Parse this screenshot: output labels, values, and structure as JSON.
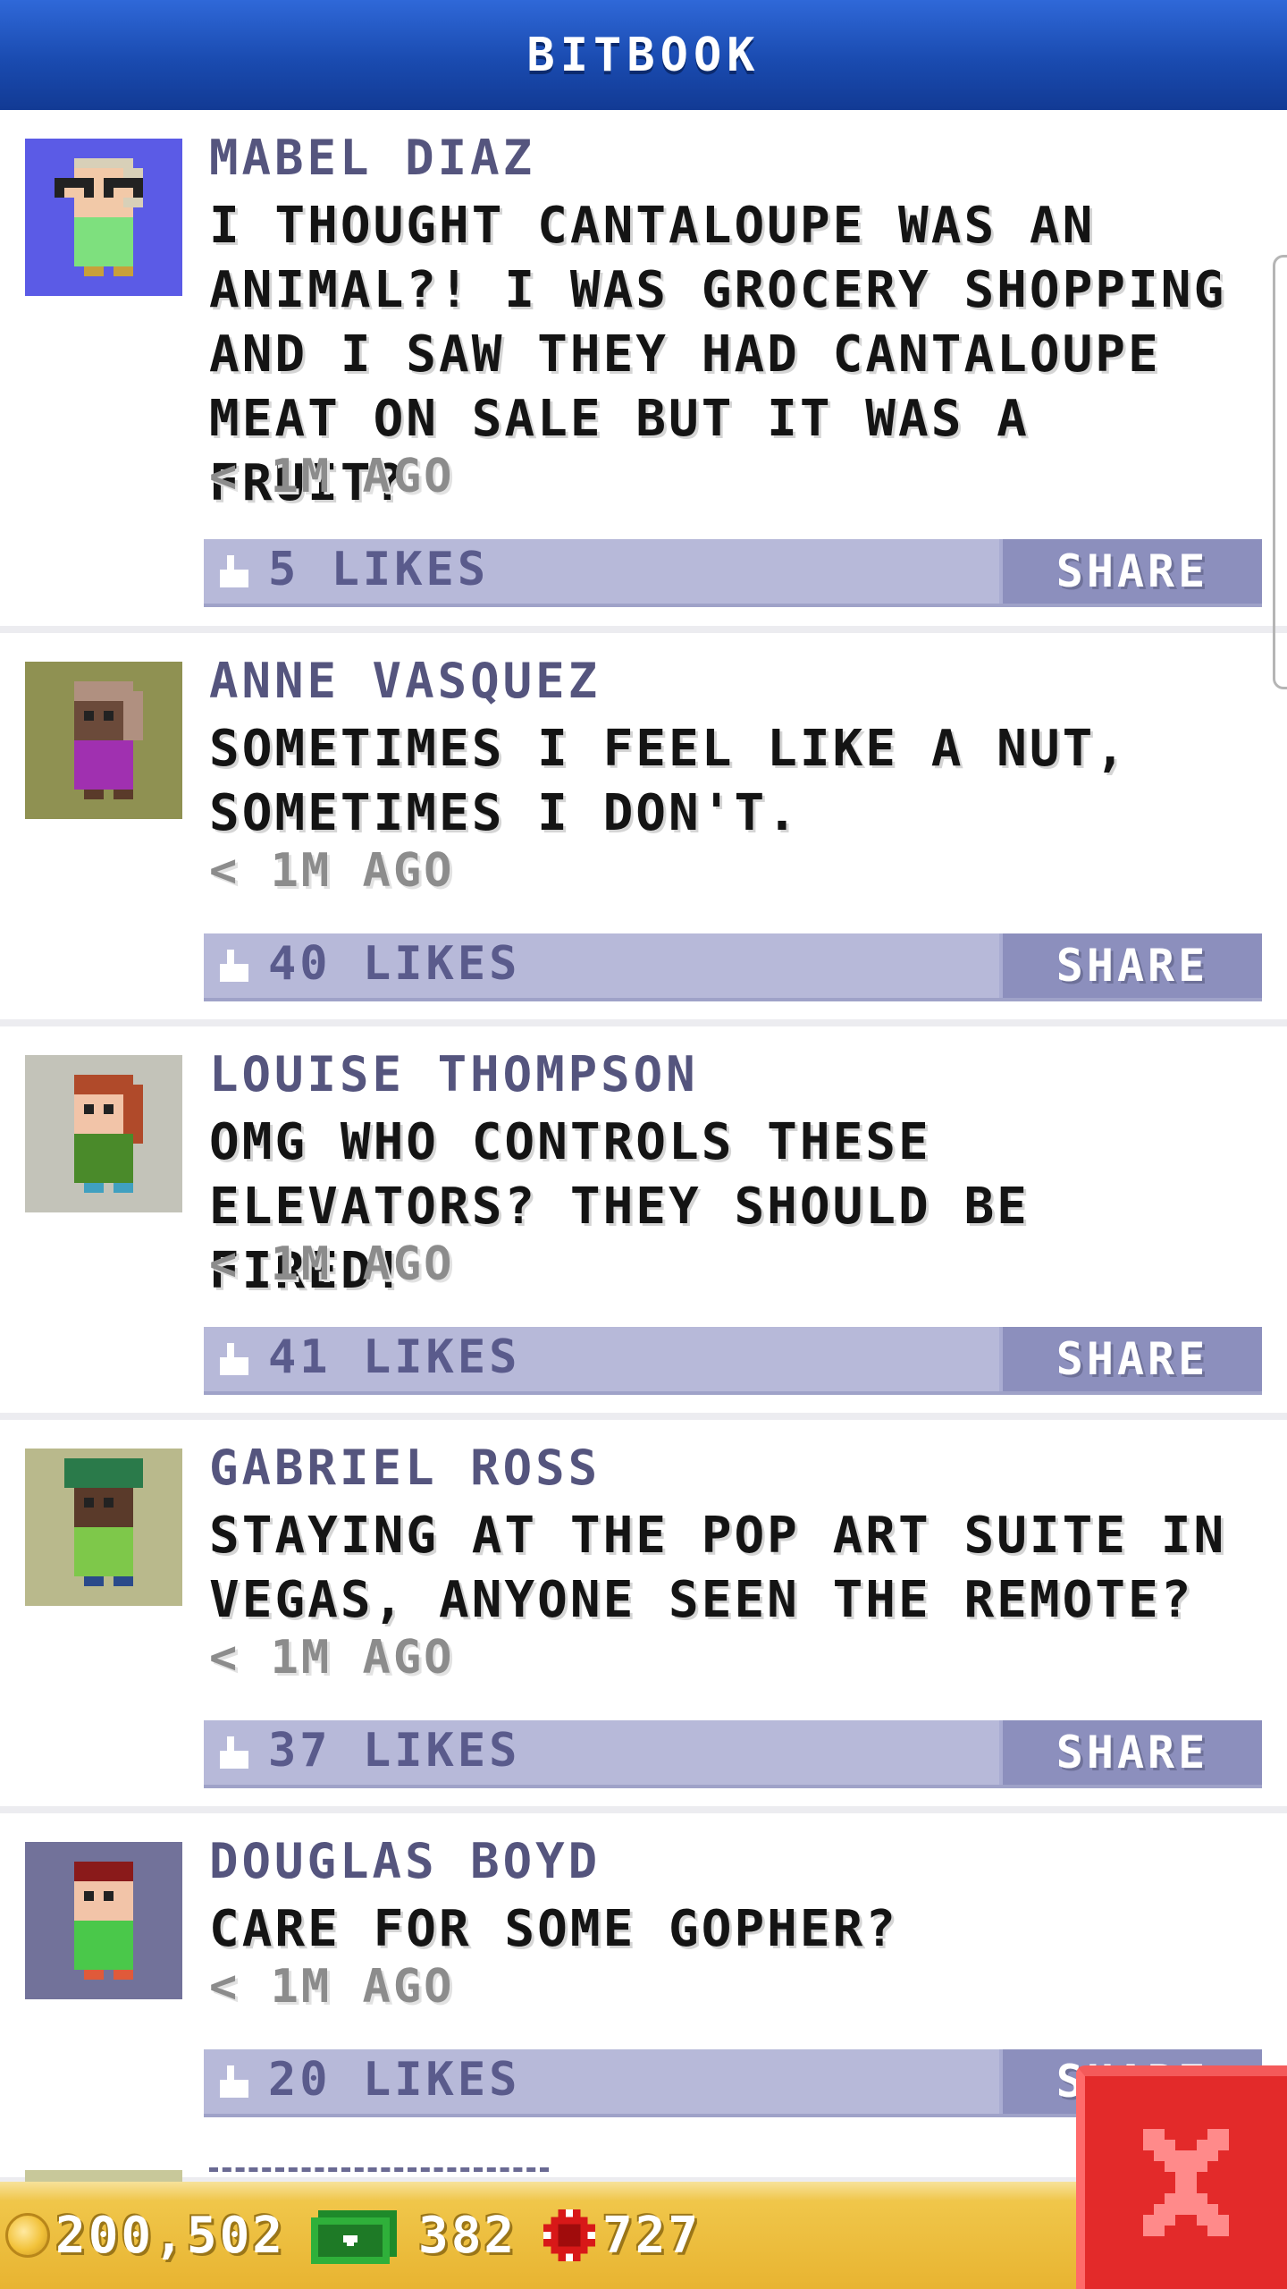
{
  "app": {
    "title": "BITBOOK"
  },
  "posts": [
    {
      "author": "MABEL DIAZ",
      "message": "I THOUGHT CANTALOUPE WAS AN ANIMAL?! I WAS GROCERY SHOPPING AND I SAW THEY HAD CANTALOUPE MEAT ON SALE BUT IT WAS A FRUIT?",
      "time": "< 1M AGO",
      "likes": "5 LIKES",
      "share_label": "SHARE",
      "avatar_bg": "#5b5be6"
    },
    {
      "author": "ANNE VASQUEZ",
      "message": "SOMETIMES I FEEL LIKE A NUT, SOMETIMES I DON'T.",
      "time": "< 1M AGO",
      "likes": "40 LIKES",
      "share_label": "SHARE",
      "avatar_bg": "#8f9152"
    },
    {
      "author": "LOUISE THOMPSON",
      "message": "OMG WHO CONTROLS THESE ELEVATORS? THEY SHOULD BE FIRED!",
      "time": "< 1M AGO",
      "likes": "41 LIKES",
      "share_label": "SHARE",
      "avatar_bg": "#c3c3b9"
    },
    {
      "author": "GABRIEL ROSS",
      "message": "STAYING AT THE POP ART SUITE IN VEGAS, ANYONE SEEN THE REMOTE?",
      "time": "< 1M AGO",
      "likes": "37 LIKES",
      "share_label": "SHARE",
      "avatar_bg": "#b9b98c"
    },
    {
      "author": "DOUGLAS BOYD",
      "message": "CARE FOR SOME GOPHER?",
      "time": "< 1M AGO",
      "likes": "20 LIKES",
      "share_label": "SHARE",
      "avatar_bg": "#72729a"
    }
  ],
  "status": {
    "coins": "200,502",
    "bux": "382",
    "chips": "727"
  },
  "icons": {
    "like": "thumbs-up-icon",
    "coin": "coin-icon",
    "bux": "bux-cash-icon",
    "chip": "casino-chip-icon",
    "close": "close-icon"
  },
  "colors": {
    "header": "#1a4bb0",
    "author": "#55557e",
    "like_bar": "#b7b9d9",
    "share_button": "#8c8fbd",
    "status_bar": "#e8b431",
    "close_button": "#e32a2a"
  }
}
